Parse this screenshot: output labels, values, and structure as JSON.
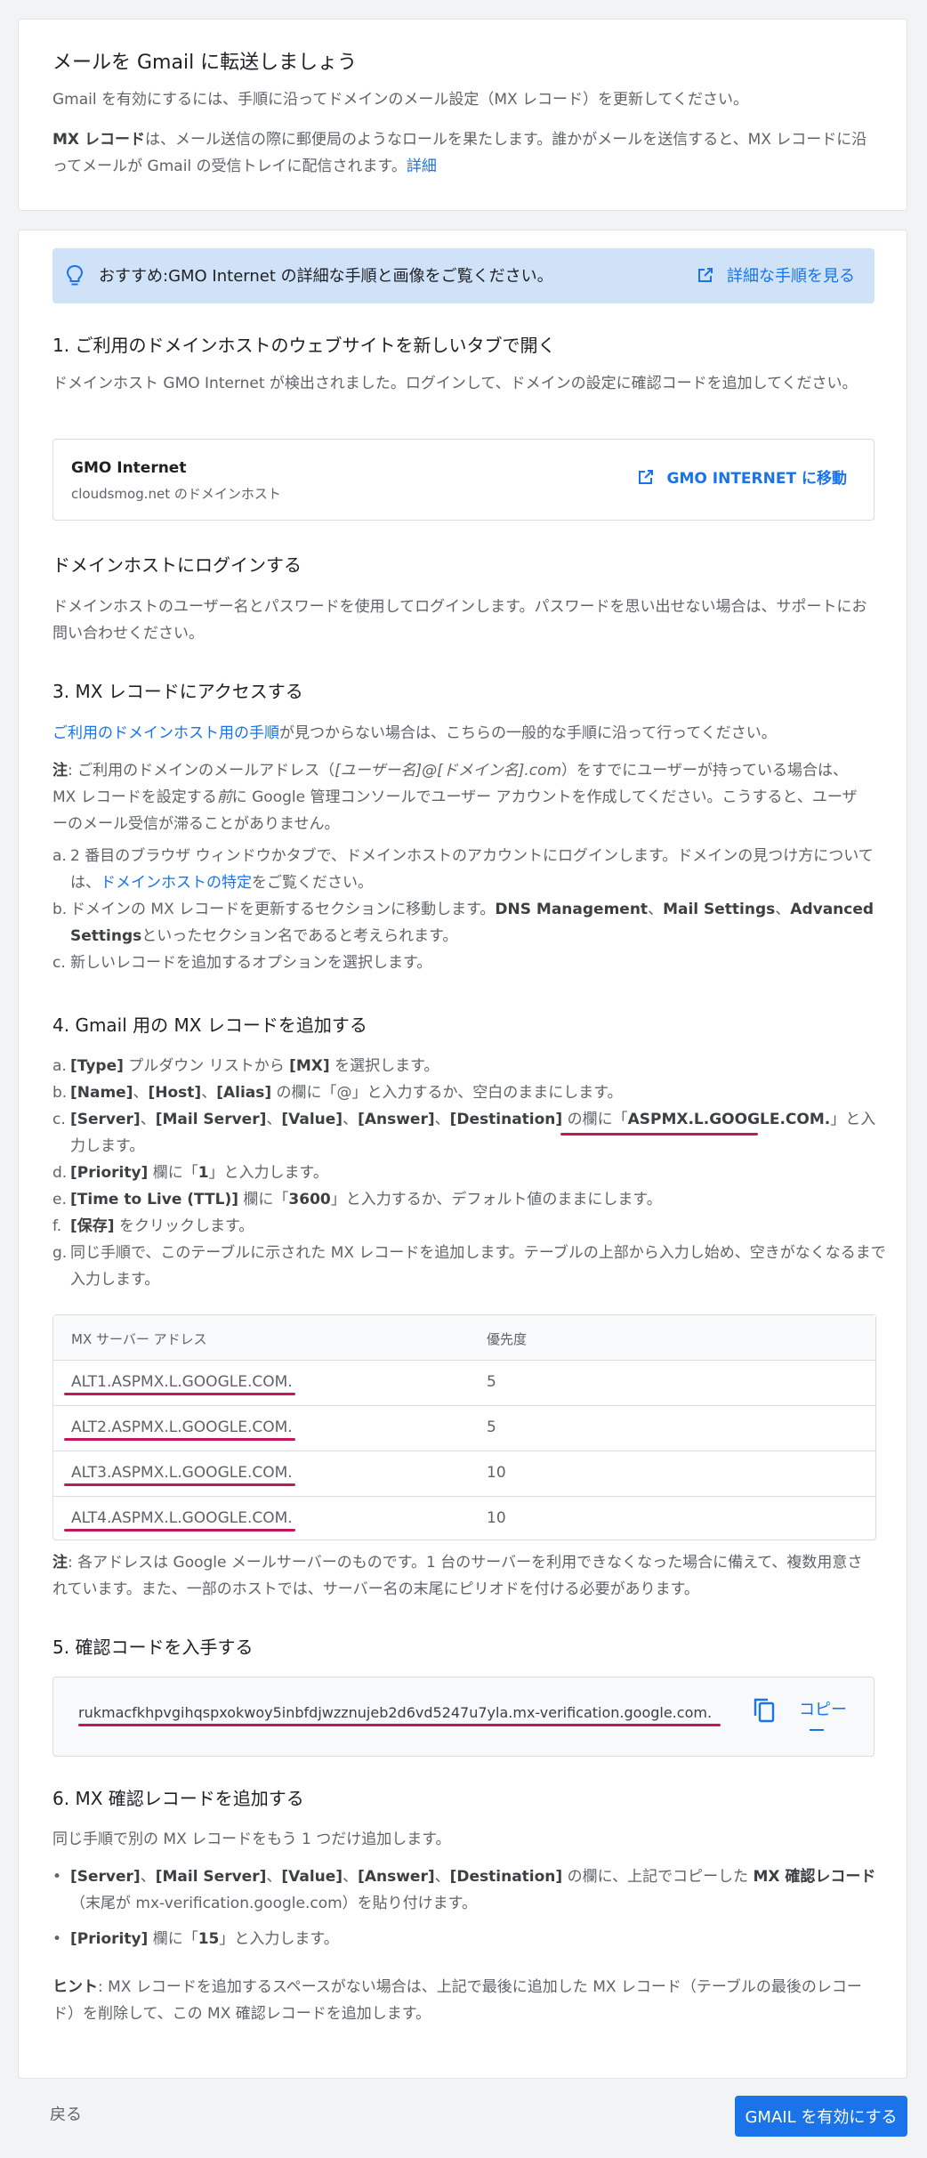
{
  "intro": {
    "title": "メールを Gmail に転送しましょう",
    "desc": "Gmail を有効にするには、手順に沿ってドメインのメール設定（MX レコード）を更新してください。",
    "mx_bold": "MX レコード",
    "mx_text": "は、メール送信の際に郵便局のようなロールを果たします。誰かがメールを送信すると、MX レコードに沿ってメールが Gmail の受信トレイに配信されます。",
    "detail_link": "詳細"
  },
  "recommend": {
    "text": "おすすめ:GMO Internet の詳細な手順と画像をご覧ください。",
    "link": "詳細な手順を見る"
  },
  "step1": {
    "title": "1. ご利用のドメインホストのウェブサイトを新しいタブで開く",
    "desc": "ドメインホスト GMO Internet が検出されました。ログインして、ドメインの設定に確認コードを追加してください。",
    "host_name": "GMO Internet",
    "host_sub": "cloudsmog.net のドメインホスト",
    "host_link": "GMO INTERNET に移動"
  },
  "step2": {
    "title": "ドメインホストにログインする",
    "desc": "ドメインホストのユーザー名とパスワードを使用してログインします。パスワードを思い出せない場合は、サポートにお問い合わせください。"
  },
  "step3": {
    "title": "3. MX レコードにアクセスする",
    "link": "ご利用のドメインホスト用の手順",
    "link_rest": "が見つからない場合は、こちらの一般的な手順に沿って行ってください。",
    "note_label": "注",
    "note_a": ": ご利用のドメインのメールアドレス（",
    "note_italic": "[ユーザー名]@[ドメイン名].com",
    "note_b": "）をすでにユーザーが持っている場合は、MX レコードを設定する",
    "note_before": "前",
    "note_c": "に Google 管理コンソールでユーザー アカウントを作成してください。こうすると、ユーザーのメール受信が滞ることがありません。",
    "a_marker": "a.",
    "a_text": "2 番目のブラウザ ウィンドウかタブで、ドメインホストのアカウントにログインします。ドメインの見つけ方については、",
    "a_link": "ドメインホストの特定",
    "a_rest": "をご覧ください。",
    "b_marker": "b.",
    "b_text": "ドメインの MX レコードを更新するセクションに移動します。",
    "b_bold1": "DNS Management",
    "b_sep1": "、",
    "b_bold2": "Mail Settings",
    "b_sep2": "、",
    "b_bold3": "Advanced Settings",
    "b_rest": "といったセクション名であると考えられます。",
    "c_marker": "c.",
    "c_text": "新しいレコードを追加するオプションを選択します。"
  },
  "step4": {
    "title": "4. Gmail 用の MX レコードを追加する",
    "a_marker": "a.",
    "a_b1": "[Type]",
    "a_t1": " プルダウン リストから ",
    "a_b2": "[MX]",
    "a_t2": " を選択します。",
    "b_marker": "b.",
    "b_b1": "[Name]",
    "b_t1": "、",
    "b_b2": "[Host]",
    "b_t2": "、",
    "b_b3": "[Alias]",
    "b_t3": " の欄に「@」と入力するか、空白のままにします。",
    "c_marker": "c.",
    "c_b1": "[Server]",
    "c_t1": "、",
    "c_b2": "[Mail Server]",
    "c_t2": "、",
    "c_b3": "[Value]",
    "c_t3": "、",
    "c_b4": "[Answer]",
    "c_t4": "、",
    "c_b5": "[Destination]",
    "c_t5": " の欄に「",
    "c_val": "ASPMX.L.GOOGLE.COM.",
    "c_t6": "」と入力します。",
    "d_marker": "d.",
    "d_b1": "[Priority]",
    "d_t1": " 欄に「",
    "d_val": "1",
    "d_t2": "」と入力します。",
    "e_marker": "e.",
    "e_b1": "[Time to Live (TTL)]",
    "e_t1": " 欄に「",
    "e_val": "3600",
    "e_t2": "」と入力するか、デフォルト値のままにします。",
    "f_marker": "f.",
    "f_b1": "[保存]",
    "f_t1": " をクリックします。",
    "g_marker": "g.",
    "g_text": "同じ手順で、このテーブルに示された MX レコードを追加します。テーブルの上部から入力し始め、空きがなくなるまで入力します。",
    "table": {
      "col1": "MX サーバー アドレス",
      "col2": "優先度",
      "rows": [
        {
          "server": "ALT1.ASPMX.L.GOOGLE.COM.",
          "priority": "5"
        },
        {
          "server": "ALT2.ASPMX.L.GOOGLE.COM.",
          "priority": "5"
        },
        {
          "server": "ALT3.ASPMX.L.GOOGLE.COM.",
          "priority": "10"
        },
        {
          "server": "ALT4.ASPMX.L.GOOGLE.COM.",
          "priority": "10"
        }
      ]
    },
    "note_label": "注",
    "note_text": ": 各アドレスは Google メールサーバーのものです。1 台のサーバーを利用できなくなった場合に備えて、複数用意されています。また、一部のホストでは、サーバー名の末尾にピリオドを付ける必要があります。"
  },
  "step5": {
    "title": "5. 確認コードを入手する",
    "code": "rukmacfkhpvgihqspxokwoy5inbfdjwzznujeb2d6vd5247u7yla.mx-verification.google.com.",
    "copy_label": "コピー"
  },
  "step6": {
    "title": "6. MX 確認レコードを追加する",
    "desc": "同じ手順で別の MX レコードをもう 1 つだけ追加します。",
    "b1_b1": "[Server]",
    "b1_t1": "、",
    "b1_b2": "[Mail Server]",
    "b1_t2": "、",
    "b1_b3": "[Value]",
    "b1_t3": "、",
    "b1_b4": "[Answer]",
    "b1_t4": "、",
    "b1_b5": "[Destination]",
    "b1_t5": " の欄に、上記でコピーした ",
    "b1_b6": "MX 確認レコード",
    "b1_t6": "（末尾が mx-verification.google.com）を貼り付けます。",
    "b2_b1": "[Priority]",
    "b2_t1": " 欄に「",
    "b2_val": "15",
    "b2_t2": "」と入力します。",
    "hint_label": "ヒント",
    "hint_text": ": MX レコードを追加するスペースがない場合は、上記で最後に追加した MX レコード（テーブルの最後のレコード）を削除して、この MX 確認レコードを追加します。"
  },
  "footer": {
    "back": "戻る",
    "enable": "GMAIL を有効にする"
  },
  "colors": {
    "accent": "#1a73e8",
    "recommend_bg": "#cfe2f8",
    "annotation_underline": "#c2185b"
  }
}
